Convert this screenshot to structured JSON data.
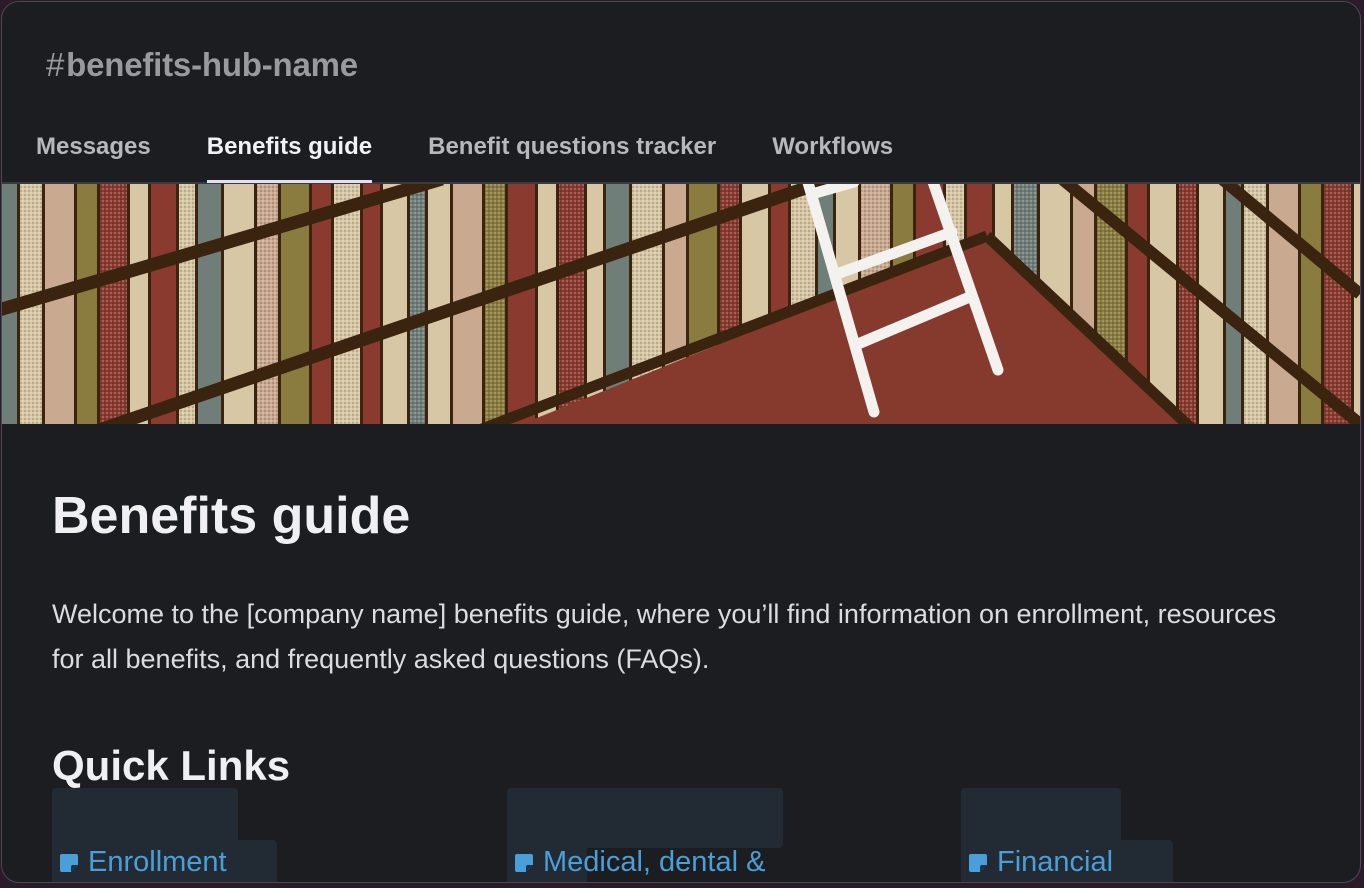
{
  "channel": {
    "hash": "#",
    "name": "benefits-hub-name"
  },
  "tabs": [
    {
      "label": "Messages",
      "active": false
    },
    {
      "label": "Benefits guide",
      "active": true
    },
    {
      "label": "Benefit questions tracker",
      "active": false
    },
    {
      "label": "Workflows",
      "active": false
    }
  ],
  "banner": {
    "icon": "bookshelf-ladder-illustration"
  },
  "canvas": {
    "title": "Benefits guide",
    "intro": "Welcome to the [company name] benefits guide, where you’ll find information on enrollment, resources for all benefits, and frequently asked questions (FAQs).",
    "section_title": "Quick Links",
    "links": [
      {
        "label": "Enrollment",
        "icon": "document-icon"
      },
      {
        "label": "Medical, dental &",
        "icon": "document-icon"
      },
      {
        "label": "Financial",
        "icon": "document-icon"
      }
    ]
  },
  "colors": {
    "background": "#1c1d21",
    "link": "#4a9fd8",
    "active_tab_underline": "#e6dff2",
    "banner_floor": "#863a2e",
    "banner_wood": "#3a230f"
  }
}
